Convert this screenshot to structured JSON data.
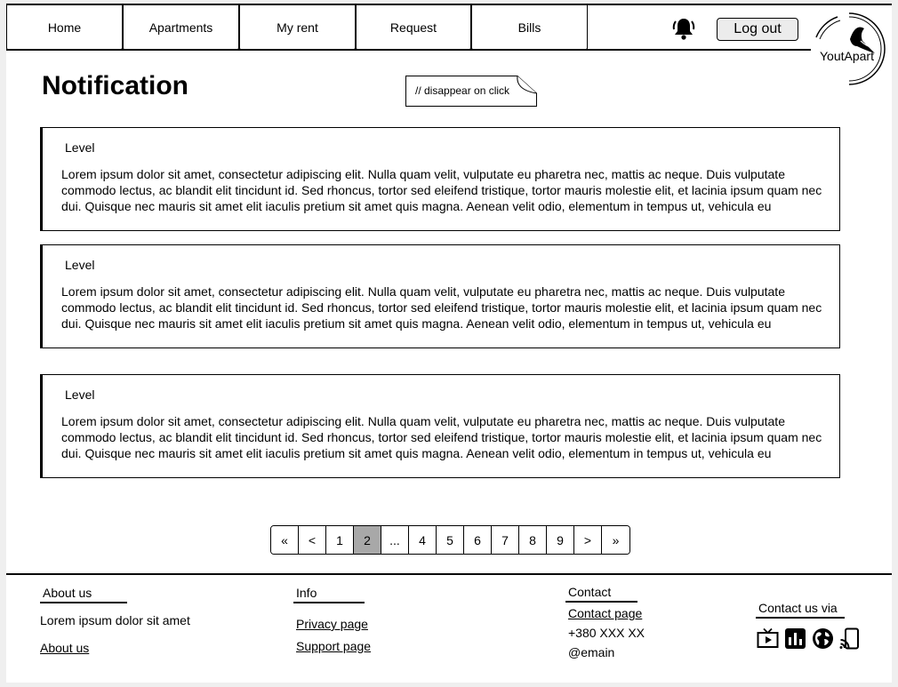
{
  "nav": {
    "tabs": [
      {
        "label": "Home"
      },
      {
        "label": "Apartments"
      },
      {
        "label": "My rent"
      },
      {
        "label": "Request"
      },
      {
        "label": "Bills"
      }
    ],
    "logout_label": "Log out",
    "logo_text": "YoutApart"
  },
  "main": {
    "title": "Notification",
    "note": "// disappear on click",
    "cards": [
      {
        "level": "Level",
        "text": "Lorem ipsum dolor sit amet, consectetur adipiscing elit. Nulla quam velit, vulputate eu pharetra nec, mattis ac neque. Duis vulputate commodo lectus, ac blandit elit tincidunt id. Sed rhoncus, tortor sed eleifend tristique, tortor mauris molestie elit, et lacinia ipsum quam nec dui. Quisque nec mauris sit amet elit iaculis pretium sit amet quis magna. Aenean velit odio, elementum in tempus ut, vehicula eu"
      },
      {
        "level": "Level",
        "text": "Lorem ipsum dolor sit amet, consectetur adipiscing elit. Nulla quam velit, vulputate eu pharetra nec, mattis ac neque. Duis vulputate commodo lectus, ac blandit elit tincidunt id. Sed rhoncus, tortor sed eleifend tristique, tortor mauris molestie elit, et lacinia ipsum quam nec dui. Quisque nec mauris sit amet elit iaculis pretium sit amet quis magna. Aenean velit odio, elementum in tempus ut, vehicula eu"
      },
      {
        "level": "Level",
        "text": "Lorem ipsum dolor sit amet, consectetur adipiscing elit. Nulla quam velit, vulputate eu pharetra nec, mattis ac neque. Duis vulputate commodo lectus, ac blandit elit tincidunt id. Sed rhoncus, tortor sed eleifend tristique, tortor mauris molestie elit, et lacinia ipsum quam nec dui. Quisque nec mauris sit amet elit iaculis pretium sit amet quis magna. Aenean velit odio, elementum in tempus ut, vehicula eu"
      }
    ]
  },
  "pagination": {
    "first": "«",
    "prev": "<",
    "pages": [
      "1",
      "2",
      "...",
      "4",
      "5",
      "6",
      "7",
      "8",
      "9"
    ],
    "active_page": "2",
    "next": ">",
    "last": "»"
  },
  "footer": {
    "about": {
      "heading": "About us",
      "text": "Lorem ipsum dolor sit amet",
      "link": "About us"
    },
    "info": {
      "heading": "Info",
      "links": [
        "Privacy page",
        "Support page"
      ]
    },
    "contact": {
      "heading": "Contact",
      "link": "Contact page",
      "phone": "+380 XXX XX",
      "email": "@emain"
    },
    "social": {
      "heading": "Contact us via",
      "icons": [
        "tv-play-icon",
        "bar-chart-icon",
        "globe-icon",
        "cast-icon"
      ]
    }
  }
}
